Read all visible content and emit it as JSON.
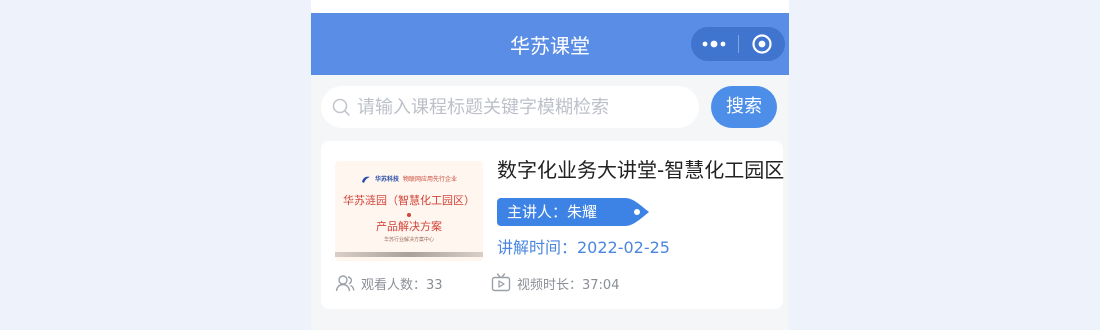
{
  "app": {
    "title": "华苏课堂",
    "accent_color": "#5a8ee6",
    "capsule_icons": [
      "more-dots-icon",
      "close-target-icon"
    ]
  },
  "search": {
    "placeholder": "请输入课程标题关键字模糊检索",
    "value": "",
    "button_label": "搜索"
  },
  "course": {
    "title": "数字化业务大讲堂-智慧化工园区",
    "lecturer": "主讲人：朱耀",
    "lecture_time": "讲解时间：2022-02-25",
    "views": "观看人数：33",
    "duration": "视频时长：37:04",
    "thumbnail": {
      "logo": "华苏科技",
      "logo_sub": "物联网应用先行企业",
      "line1": "华苏涟园（智慧化工园区）",
      "line2": "产品解决方案",
      "line3": "华苏行业解决方案中心"
    }
  }
}
